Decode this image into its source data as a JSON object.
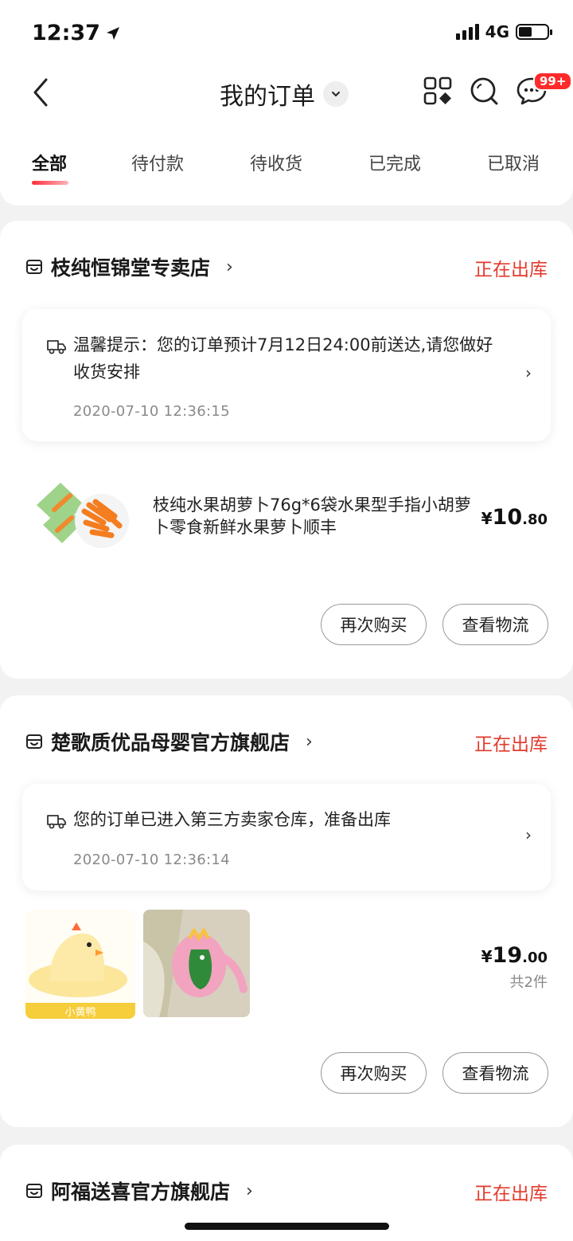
{
  "status_bar": {
    "time": "12:37",
    "network": "4G"
  },
  "header": {
    "title": "我的订单",
    "message_badge": "99+"
  },
  "tabs": [
    {
      "label": "全部",
      "active": true
    },
    {
      "label": "待付款"
    },
    {
      "label": "待收货"
    },
    {
      "label": "已完成"
    },
    {
      "label": "已取消"
    }
  ],
  "orders": [
    {
      "shop": "枝纯恒锦堂专卖店",
      "status": "正在出库",
      "tip_text_line1": "温馨提示：您的订单预计7月12日24:00前送达,请您做好",
      "tip_text_line2": "收货安排",
      "tip_time": "2020-07-10 12:36:15",
      "product_title": "枝纯水果胡萝卜76g*6袋水果型手指小胡萝卜零食新鲜水果萝卜顺丰",
      "price_symbol": "¥",
      "price_int": "10",
      "price_dec": ".80",
      "buttons": [
        "再次购买",
        "查看物流"
      ]
    },
    {
      "shop": "楚歌质优品母婴官方旗舰店",
      "status": "正在出库",
      "tip_text_line1": "您的订单已进入第三方卖家仓库，准备出库",
      "tip_time": "2020-07-10 12:36:14",
      "image_caption": "小黄鸭",
      "price_symbol": "¥",
      "price_int": "19",
      "price_dec": ".00",
      "quantity": "共2件",
      "buttons": [
        "再次购买",
        "查看物流"
      ]
    },
    {
      "shop": "阿福送喜官方旗舰店",
      "status": "正在出库"
    }
  ],
  "colors": {
    "accent": "#e23a2d",
    "badge": "#ff2b2b"
  },
  "icons": [
    "back-arrow-icon",
    "chevron-down-icon",
    "apps-grid-icon",
    "search-icon",
    "message-icon",
    "shop-icon",
    "truck-icon",
    "chevron-right-icon",
    "location-arrow-icon"
  ]
}
